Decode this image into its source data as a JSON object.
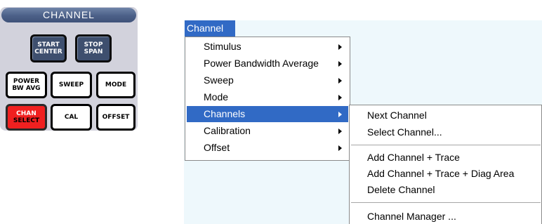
{
  "panel": {
    "title": "CHANNEL",
    "keys": {
      "start_center": "START\nCENTER",
      "stop_span": "STOP\nSPAN",
      "power_bw_avg": "POWER\nBW AVG",
      "sweep": "SWEEP",
      "mode": "MODE",
      "chan_select_top": "CHAN",
      "chan_select_bottom": "SELECT",
      "cal": "CAL",
      "offset": "OFFSET"
    }
  },
  "menubar": {
    "channel": "Channel"
  },
  "menu": {
    "items": [
      {
        "label": "Stimulus",
        "submenu": true
      },
      {
        "label": "Power Bandwidth Average",
        "submenu": true
      },
      {
        "label": "Sweep",
        "submenu": true
      },
      {
        "label": "Mode",
        "submenu": true
      },
      {
        "label": "Channels",
        "submenu": true,
        "highlighted": true
      },
      {
        "label": "Calibration",
        "submenu": true
      },
      {
        "label": "Offset",
        "submenu": true
      }
    ]
  },
  "submenu": {
    "items": [
      {
        "label": "Next Channel"
      },
      {
        "label": "Select Channel..."
      },
      {
        "label": "Add Channel + Trace"
      },
      {
        "label": "Add Channel + Trace + Diag Area"
      },
      {
        "label": "Delete Channel"
      },
      {
        "label": "Channel Manager ..."
      }
    ]
  },
  "colors": {
    "highlight": "#316ac5",
    "panel_bg": "#d2d2dc",
    "title_bar": "#4c6088",
    "dark_key": "#3e4f6e",
    "active_key": "#f02020",
    "app_bg": "#eef8fc"
  }
}
